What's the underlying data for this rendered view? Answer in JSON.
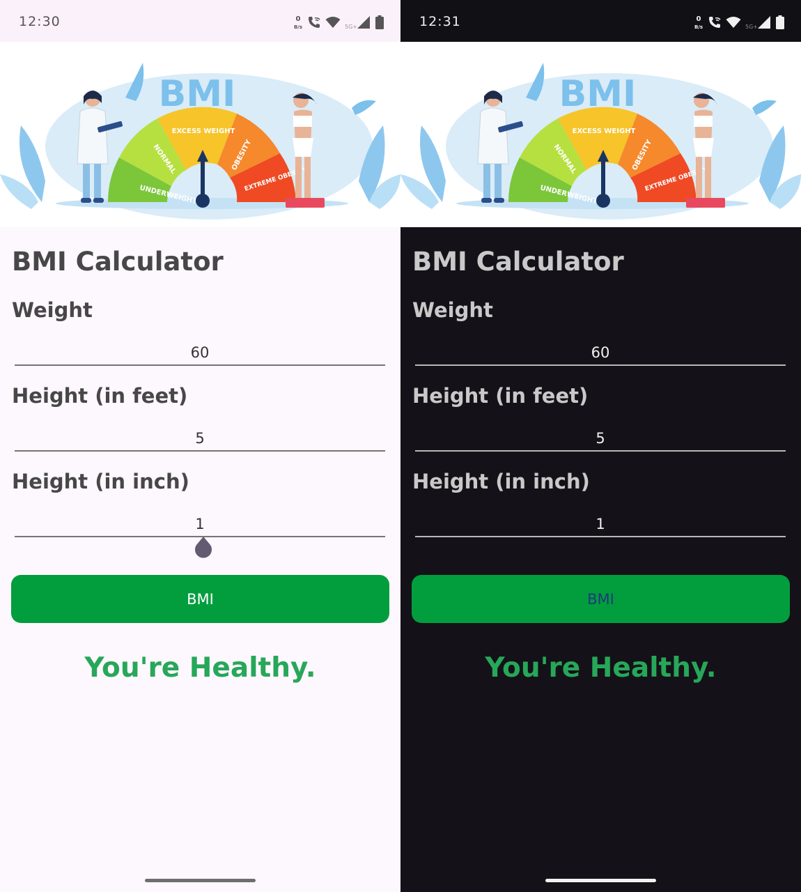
{
  "screens": [
    {
      "theme": "light",
      "status_bar": {
        "time": "12:30",
        "data_rate": "0",
        "data_unit": "B/s",
        "network": "5G+"
      },
      "hero": {
        "word": "BMI",
        "segments": [
          "UNDERWEIGHT",
          "NORMAL",
          "EXCESS WEIGHT",
          "OBESITY",
          "EXTREME OBESITY"
        ]
      },
      "title": "BMI Calculator",
      "weight": {
        "label": "Weight",
        "value": "60"
      },
      "height_feet": {
        "label": "Height (in feet)",
        "value": "5"
      },
      "height_inch": {
        "label": "Height (in inch)",
        "value": "1"
      },
      "button_label": "BMI",
      "result": "You're Healthy."
    },
    {
      "theme": "dark",
      "status_bar": {
        "time": "12:31",
        "data_rate": "0",
        "data_unit": "B/s",
        "network": "5G+"
      },
      "hero": {
        "word": "BMI",
        "segments": [
          "UNDERWEIGHT",
          "NORMAL",
          "EXCESS WEIGHT",
          "OBESITY",
          "EXTREME OBESITY"
        ]
      },
      "title": "BMI Calculator",
      "weight": {
        "label": "Weight",
        "value": "60"
      },
      "height_feet": {
        "label": "Height (in feet)",
        "value": "5"
      },
      "height_inch": {
        "label": "Height (in inch)",
        "value": "1"
      },
      "button_label": "BMI",
      "result": "You're Healthy."
    }
  ],
  "colors": {
    "light_background": "#fdf7fe",
    "dark_background": "#141218",
    "button_green": "#029e3e",
    "result_green": "#27a759",
    "gauge_underweight": "#7cc63a",
    "gauge_normal": "#b5e040",
    "gauge_excess": "#f7c42a",
    "gauge_obesity": "#f5892c",
    "gauge_extreme": "#ef4a24",
    "bmi_word": "#7cc0ec"
  },
  "icons": [
    "data-rate-icon",
    "phone-wifi-call-icon",
    "wifi-icon",
    "cell-signal-icon",
    "battery-icon",
    "gauge-needle-icon",
    "doctor-illustration",
    "woman-on-scale-illustration",
    "text-cursor-handle-icon"
  ]
}
